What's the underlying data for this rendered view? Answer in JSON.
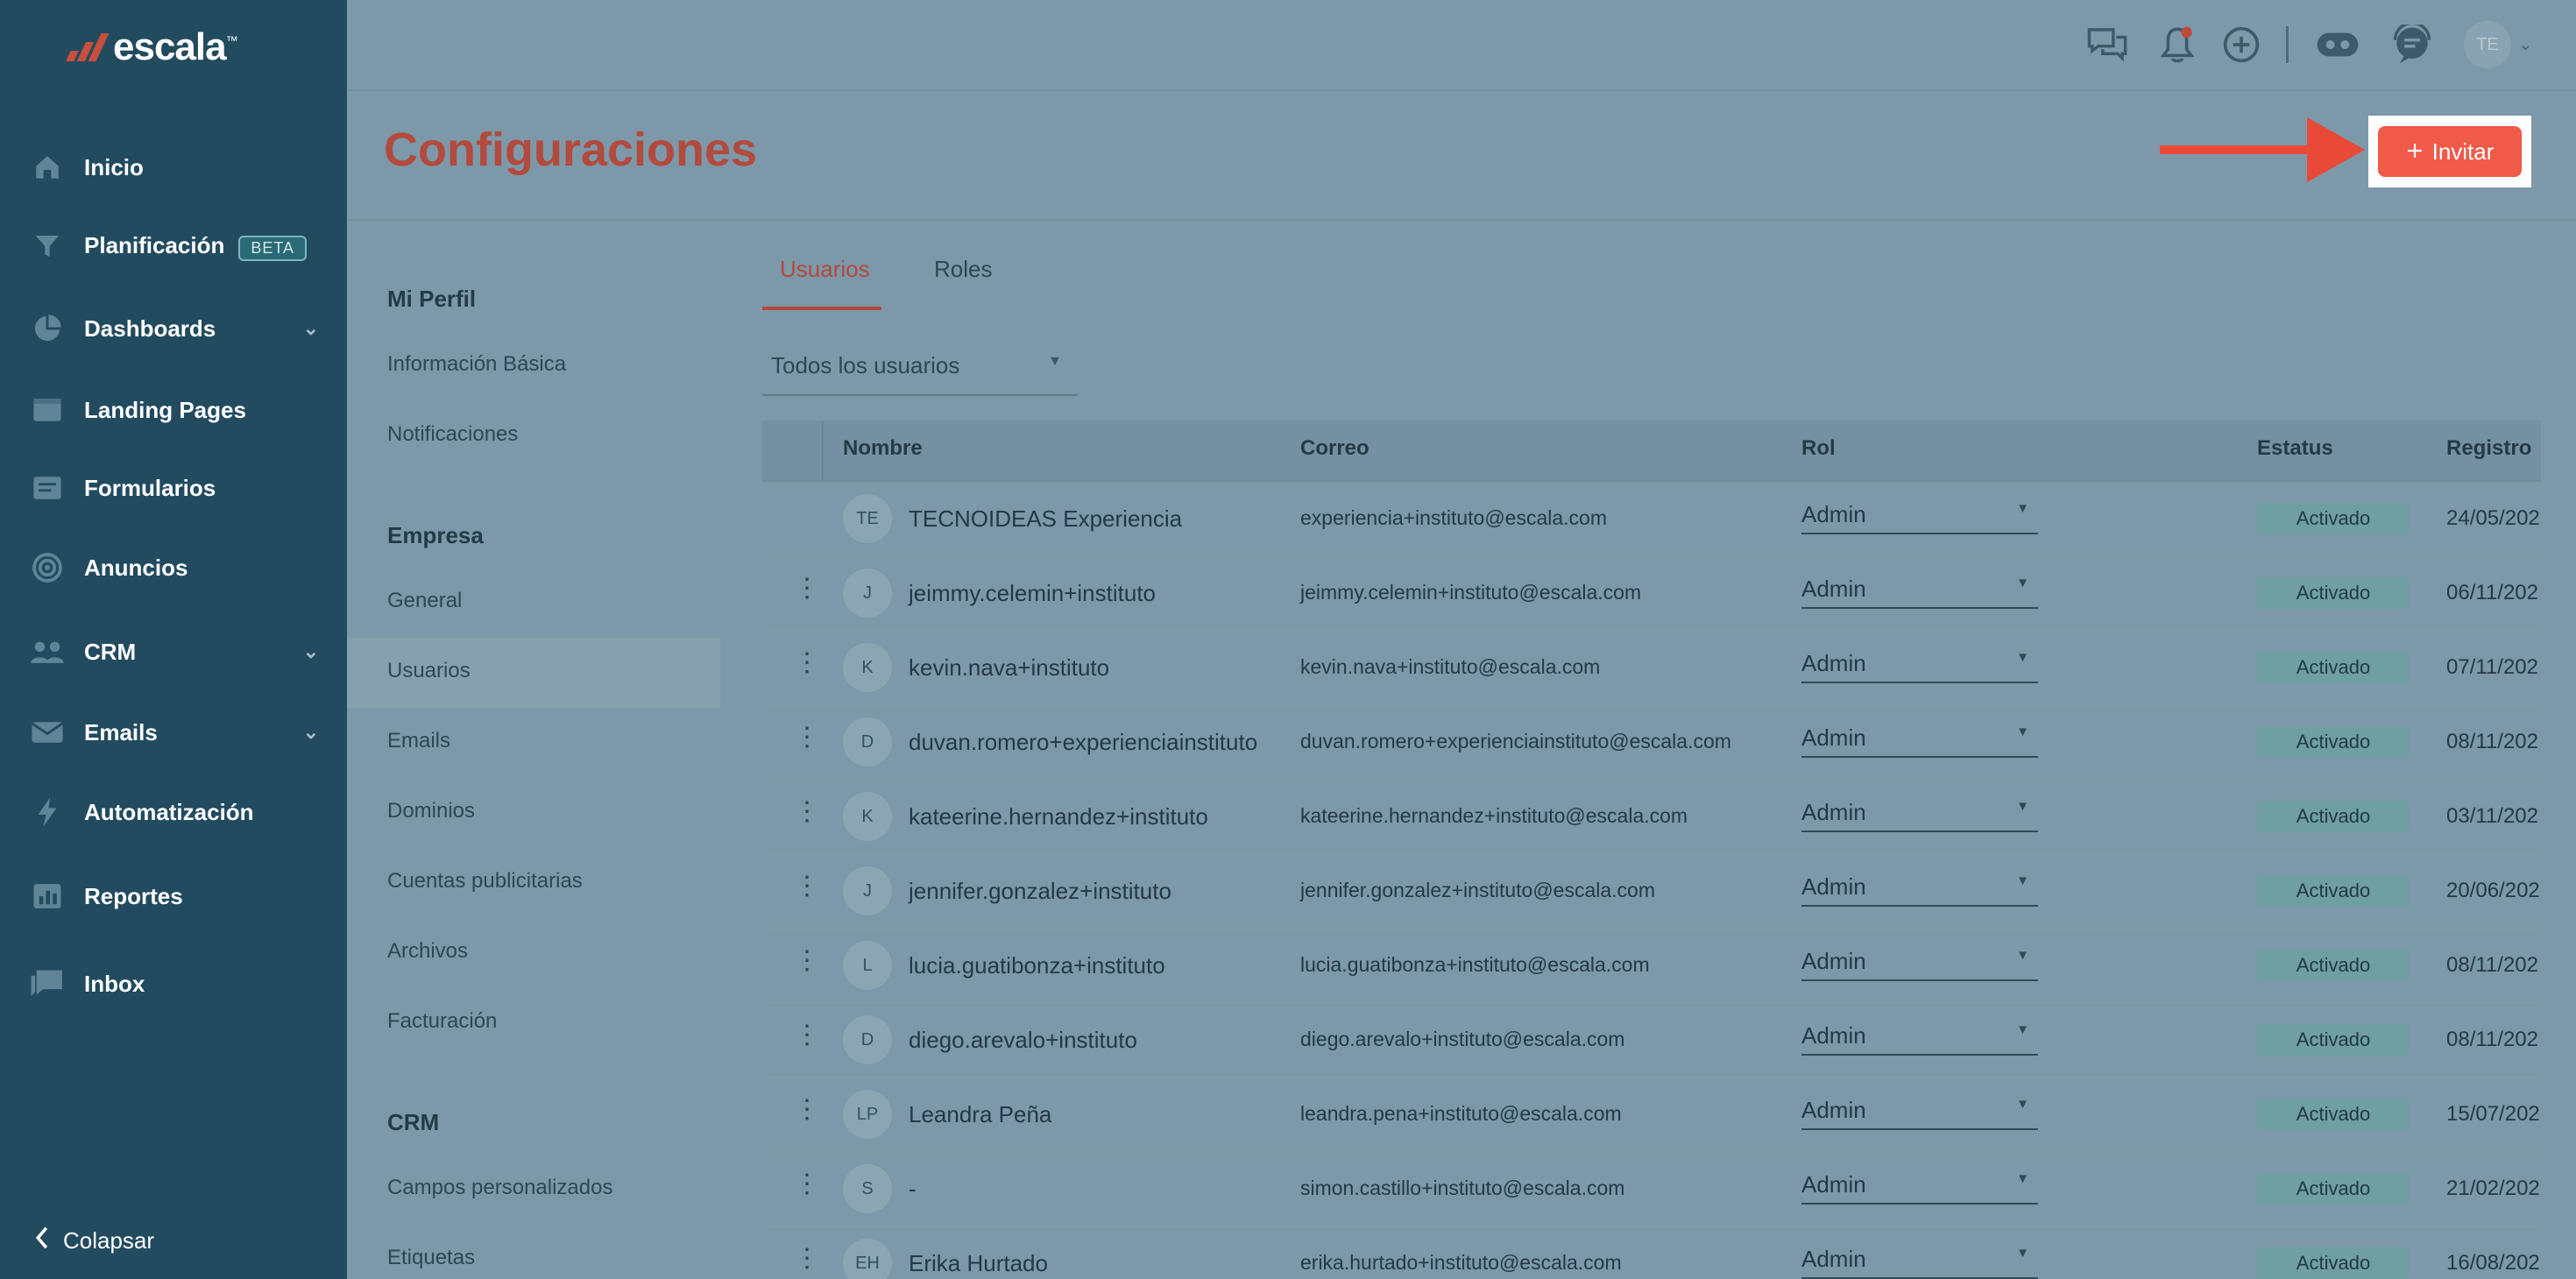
{
  "brand": {
    "name": "escala",
    "tm": "™"
  },
  "sidebar": {
    "items": [
      {
        "label": "Inicio",
        "icon": "home-icon"
      },
      {
        "label": "Planificación",
        "icon": "filter-icon",
        "badge": "BETA"
      },
      {
        "label": "Dashboards",
        "icon": "pie-chart-icon",
        "expandable": true
      },
      {
        "label": "Landing Pages",
        "icon": "browser-icon"
      },
      {
        "label": "Formularios",
        "icon": "form-icon"
      },
      {
        "label": "Anuncios",
        "icon": "target-icon"
      },
      {
        "label": "CRM",
        "icon": "users-icon",
        "expandable": true
      },
      {
        "label": "Emails",
        "icon": "envelope-icon",
        "expandable": true
      },
      {
        "label": "Automatización",
        "icon": "bolt-icon"
      },
      {
        "label": "Reportes",
        "icon": "bar-chart-icon"
      },
      {
        "label": "Inbox",
        "icon": "chat-icon"
      }
    ],
    "collapse_label": "Colapsar"
  },
  "topbar": {
    "icons": [
      "chat-bubbles-icon",
      "bell-icon",
      "plus-circle-icon",
      "gamepad-icon",
      "support-chat-icon"
    ],
    "avatar_initials": "TE"
  },
  "page": {
    "title": "Configuraciones",
    "invite_label": "Invitar"
  },
  "settings_menu": {
    "sections": [
      {
        "heading": "Mi Perfil",
        "items": [
          "Información Básica",
          "Notificaciones"
        ]
      },
      {
        "heading": "Empresa",
        "items": [
          "General",
          "Usuarios",
          "Emails",
          "Dominios",
          "Cuentas publicitarias",
          "Archivos",
          "Facturación"
        ]
      },
      {
        "heading": "CRM",
        "items": [
          "Campos personalizados",
          "Etiquetas"
        ]
      }
    ],
    "active": "Usuarios"
  },
  "tabs": [
    {
      "label": "Usuarios",
      "active": true
    },
    {
      "label": "Roles",
      "active": false
    }
  ],
  "filter": {
    "value": "Todos los usuarios"
  },
  "table": {
    "columns": [
      "Nombre",
      "Correo",
      "Rol",
      "Estatus",
      "Registro"
    ],
    "rows": [
      {
        "initials": "TE",
        "name": "TECNOIDEAS Experiencia",
        "email": "experiencia+instituto@escala.com",
        "role": "Admin",
        "status": "Activado",
        "date": "24/05/202",
        "menu": false
      },
      {
        "initials": "J",
        "name": "jeimmy.celemin+instituto",
        "email": "jeimmy.celemin+instituto@escala.com",
        "role": "Admin",
        "status": "Activado",
        "date": "06/11/202",
        "menu": true
      },
      {
        "initials": "K",
        "name": "kevin.nava+instituto",
        "email": "kevin.nava+instituto@escala.com",
        "role": "Admin",
        "status": "Activado",
        "date": "07/11/202",
        "menu": true
      },
      {
        "initials": "D",
        "name": "duvan.romero+experienciainstituto",
        "email": "duvan.romero+experienciainstituto@escala.com",
        "role": "Admin",
        "status": "Activado",
        "date": "08/11/202",
        "menu": true
      },
      {
        "initials": "K",
        "name": "kateerine.hernandez+instituto",
        "email": "kateerine.hernandez+instituto@escala.com",
        "role": "Admin",
        "status": "Activado",
        "date": "03/11/202",
        "menu": true
      },
      {
        "initials": "J",
        "name": "jennifer.gonzalez+instituto",
        "email": "jennifer.gonzalez+instituto@escala.com",
        "role": "Admin",
        "status": "Activado",
        "date": "20/06/202",
        "menu": true
      },
      {
        "initials": "L",
        "name": "lucia.guatibonza+instituto",
        "email": "lucia.guatibonza+instituto@escala.com",
        "role": "Admin",
        "status": "Activado",
        "date": "08/11/202",
        "menu": true
      },
      {
        "initials": "D",
        "name": "diego.arevalo+instituto",
        "email": "diego.arevalo+instituto@escala.com",
        "role": "Admin",
        "status": "Activado",
        "date": "08/11/202",
        "menu": true
      },
      {
        "initials": "LP",
        "name": "Leandra Peña",
        "email": "leandra.pena+instituto@escala.com",
        "role": "Admin",
        "status": "Activado",
        "date": "15/07/202",
        "menu": true
      },
      {
        "initials": "S",
        "name": "-",
        "email": "simon.castillo+instituto@escala.com",
        "role": "Admin",
        "status": "Activado",
        "date": "21/02/202",
        "menu": true
      },
      {
        "initials": "EH",
        "name": "Erika Hurtado",
        "email": "erika.hurtado+instituto@escala.com",
        "role": "Admin",
        "status": "Activado",
        "date": "16/08/202",
        "menu": true
      }
    ]
  },
  "colors": {
    "sidebar": "#224b60",
    "overlay_bg": "#7d98a8",
    "accent_red": "#ef5a49",
    "title_red": "#b24a3d",
    "status_badge": "#6f9ea3"
  }
}
